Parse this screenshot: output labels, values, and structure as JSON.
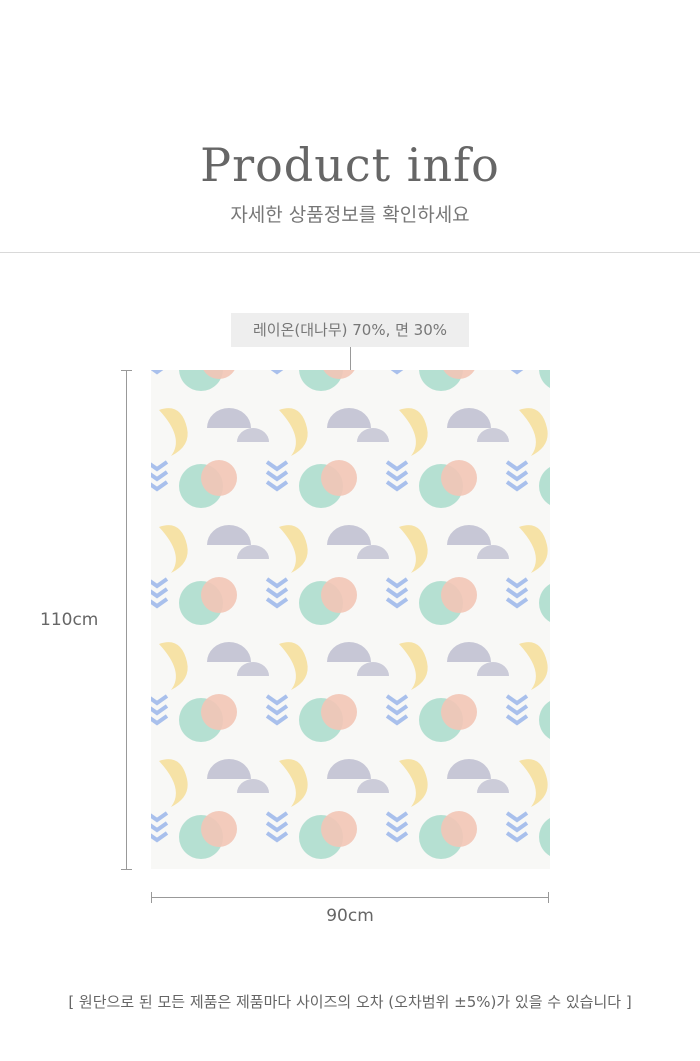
{
  "header": {
    "title": "Product info",
    "subtitle": "자세한 상품정보를 확인하세요"
  },
  "product": {
    "material": "레이온(대나무) 70%, 면 30%",
    "height": "110cm",
    "width": "90cm"
  },
  "footer": {
    "notice": "[ 원단으로 된 모든 제품은 제품마다 사이즈의 오차 (오차범위 ±5%)가 있을 수 있습니다 ]"
  },
  "pattern_colors": {
    "coral": "#f2c5b6",
    "mint": "#a9dccb",
    "lavender": "#c7c7d6",
    "yellow": "#f6e2a6",
    "blue": "#a9c0ec"
  }
}
